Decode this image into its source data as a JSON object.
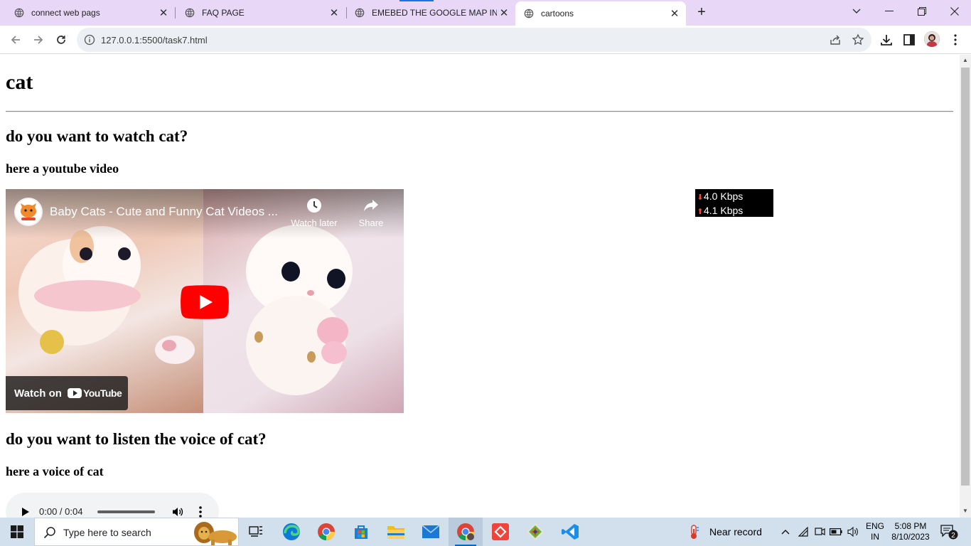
{
  "browser": {
    "tabs": [
      {
        "title": "connect web pags",
        "active": false
      },
      {
        "title": "FAQ PAGE",
        "active": false
      },
      {
        "title": "EMEBED THE GOOGLE MAP IN YO",
        "active": false
      },
      {
        "title": "cartoons",
        "active": true
      }
    ],
    "new_tab_label": "+",
    "url": "127.0.0.1:5500/task7.html"
  },
  "page": {
    "heading": "cat",
    "video_section": {
      "question": "do you want to watch cat?",
      "caption": "here a youtube video",
      "embed": {
        "title": "Baby Cats - Cute and Funny Cat Videos ...",
        "watch_later_label": "Watch later",
        "share_label": "Share",
        "watch_on_label": "Watch on",
        "youtube_wordmark": "YouTube"
      }
    },
    "audio_section": {
      "question": "do you want to listen the voice of cat?",
      "caption": "here a voice of cat",
      "player": {
        "time": "0:00 / 0:04",
        "progress": 0
      }
    }
  },
  "speed_meter": {
    "download": "4.0 Kbps",
    "upload": "4.1 Kbps"
  },
  "taskbar": {
    "search_placeholder": "Type here to search",
    "weather_text": "Near record",
    "language": "ENG",
    "region": "IN",
    "time": "5:08 PM",
    "date": "8/10/2023",
    "notification_count": "2"
  },
  "colors": {
    "tabbar": "#e8d7f7",
    "youtube_red": "#ff0000",
    "taskbar": "#d2e0ee"
  }
}
